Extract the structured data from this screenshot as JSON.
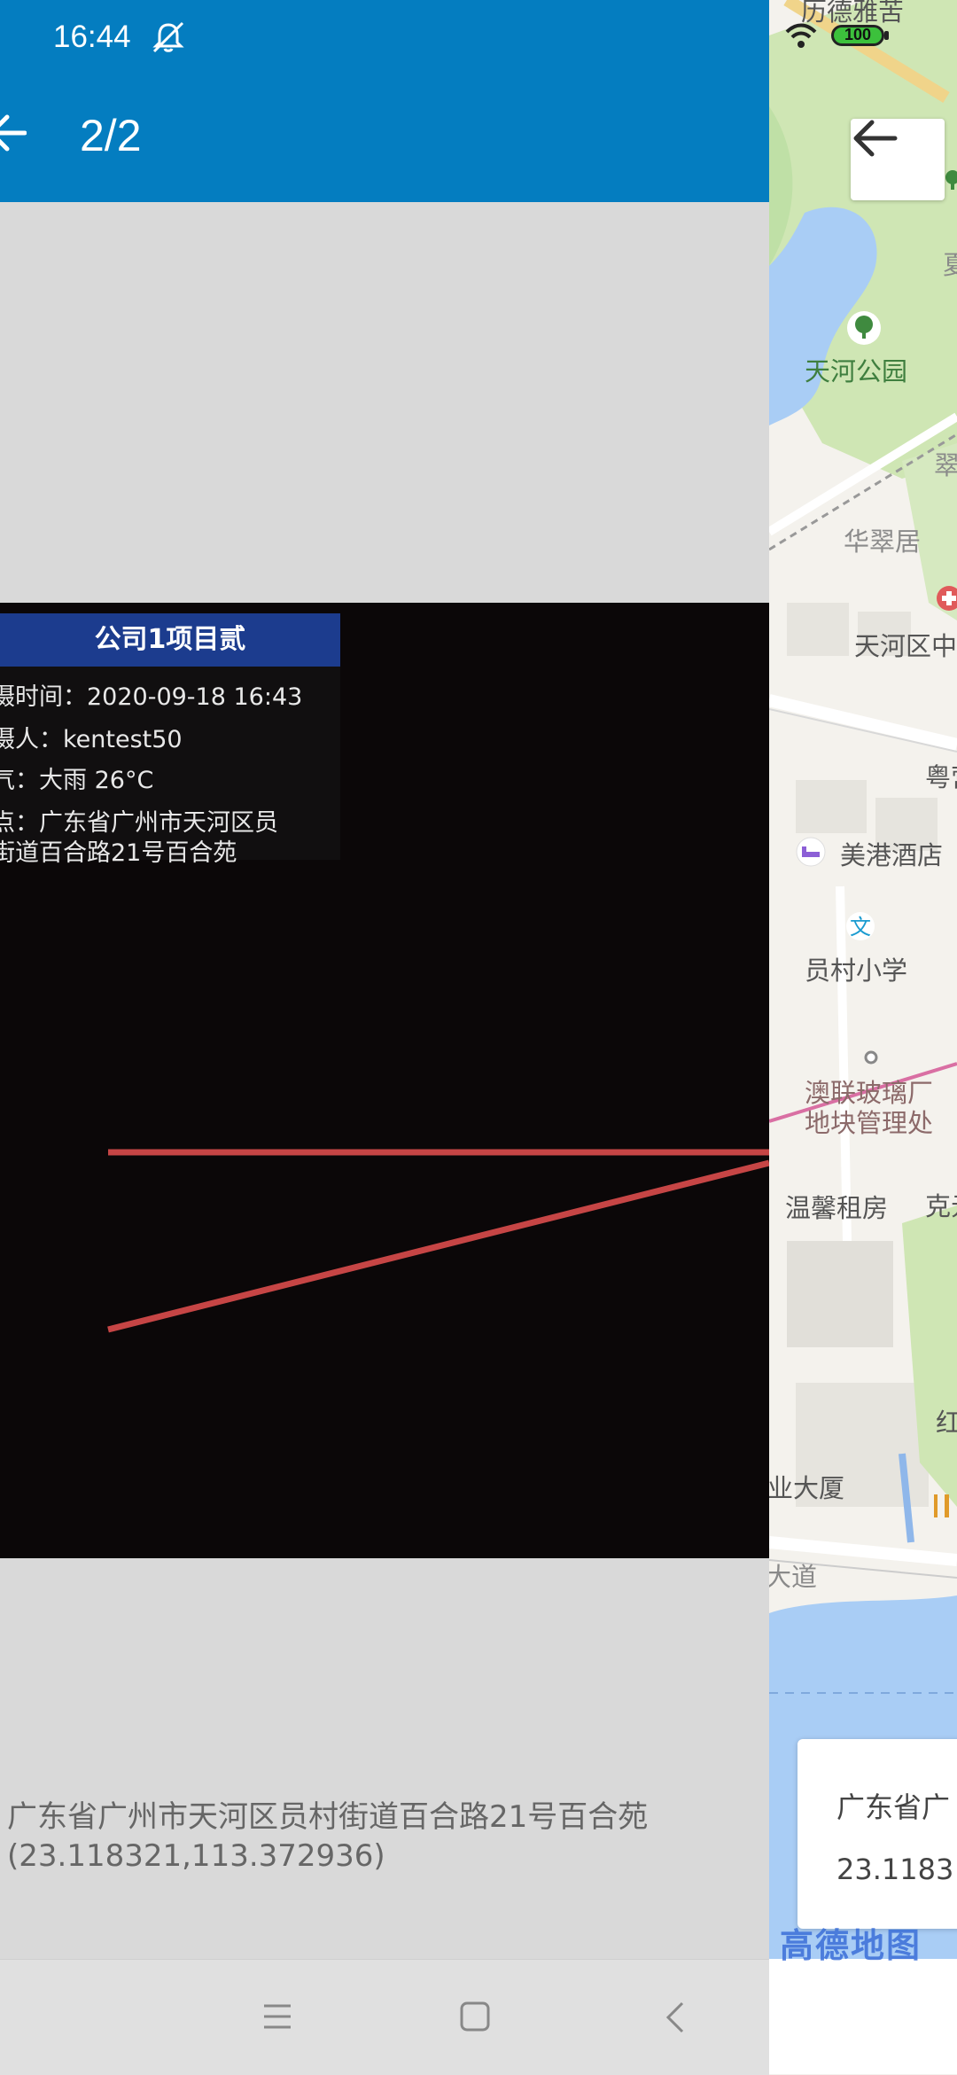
{
  "status_bar": {
    "time": "16:44",
    "battery": "100"
  },
  "app_bar": {
    "page_counter": "2/2"
  },
  "photo": {
    "watermark": {
      "title": "公司1项目贰",
      "time_row": "摄时间：2020-09-18 16:43",
      "person_row": "摄人：kentest50",
      "weather_row": "气：大雨 26°C",
      "place_row_1": "点：广东省广州市天河区员",
      "place_row_2": "街道百合路21号百合苑"
    }
  },
  "address": {
    "line": "广东省广州市天河区员村街道百合路21号百合苑",
    "coords": "(23.118321,113.372936)"
  },
  "map": {
    "labels": {
      "top": "历德雅苦",
      "park": "天河公园",
      "cui": "翠",
      "huacuiju": "华翠居",
      "district": "天河区中",
      "yue": "粤营",
      "hotel": "美港酒店",
      "school": "员村小学",
      "factory_1": "澳联玻璃厂",
      "factory_2": "地块管理处",
      "rental": "温馨租房",
      "ke": "克元",
      "hong": "红",
      "building": "业大厦",
      "avenue": "大道",
      "gray_right": "夏"
    },
    "info_card": {
      "line1": "广东省广",
      "line2": "23.1183"
    },
    "logo": "高德地图"
  }
}
